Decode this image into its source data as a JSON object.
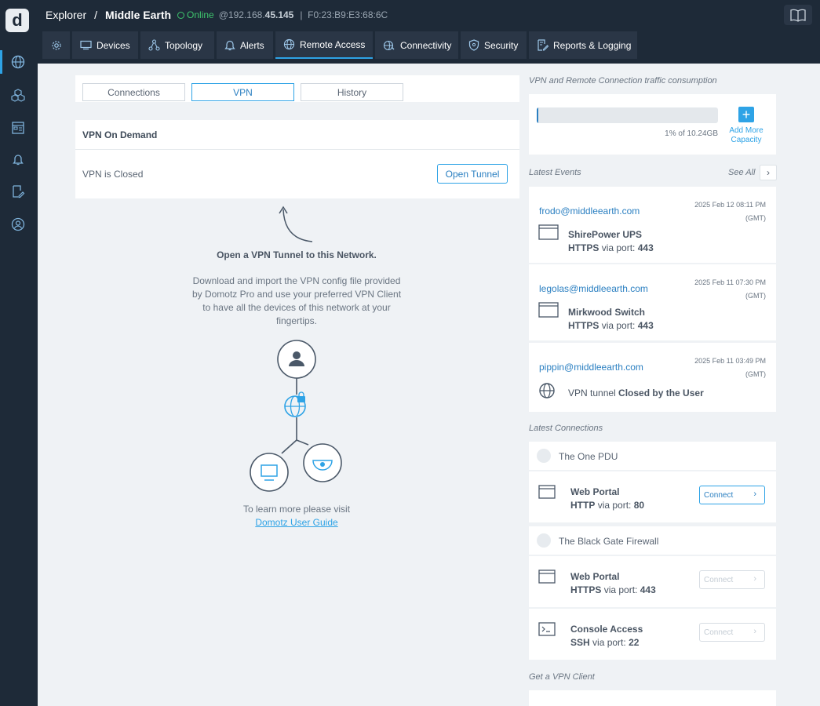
{
  "header": {
    "breadcrumb_root": "Explorer",
    "separator": "/",
    "network_name": "Middle Earth",
    "status": "Online",
    "ip_prefix": "@192.168.",
    "ip_suffix": "45.145",
    "mac_separator": "|",
    "mac": "F0:23:B9:E3:68:6C"
  },
  "tabs": [
    {
      "label": "",
      "icon": "gear-icon"
    },
    {
      "label": "Devices",
      "icon": "monitor-icon"
    },
    {
      "label": "Topology",
      "icon": "topology-icon"
    },
    {
      "label": "Alerts",
      "icon": "bell-icon"
    },
    {
      "label": "Remote Access",
      "icon": "globe-icon",
      "active": true
    },
    {
      "label": "Connectivity",
      "icon": "connectivity-icon"
    },
    {
      "label": "Security",
      "icon": "shield-icon"
    },
    {
      "label": "Reports & Logging",
      "icon": "report-icon"
    }
  ],
  "segments": {
    "connections": "Connections",
    "vpn": "VPN",
    "history": "History",
    "active": "VPN"
  },
  "vpn": {
    "title": "VPN On Demand",
    "status": "VPN is Closed",
    "open_button": "Open Tunnel",
    "empty_title": "Open a VPN Tunnel to this Network.",
    "empty_description": "Download and import the VPN config file provided by Domotz Pro and use your preferred VPN Client to have all the devices of this network at your fingertips.",
    "learn_more": "To learn more please visit",
    "guide_link": "Domotz User Guide"
  },
  "traffic": {
    "label": "VPN and Remote Connection traffic consumption",
    "usage_text": "1% of 10.24GB",
    "usage_fraction": 0.01,
    "add_capacity": "Add More Capacity"
  },
  "events": {
    "label": "Latest Events",
    "see_all": "See All",
    "items": [
      {
        "user": "frodo@middleearth.com",
        "date": "2025 Feb 12 08:11 PM",
        "tz": "(GMT)",
        "device": "ShirePower UPS",
        "proto": "HTTPS",
        "via": "via port:",
        "port": "443"
      },
      {
        "user": "legolas@middleearth.com",
        "date": "2025 Feb 11 07:30 PM",
        "tz": "(GMT)",
        "device": "Mirkwood Switch",
        "proto": "HTTPS",
        "via": "via port:",
        "port": "443"
      },
      {
        "user": "pippin@middleearth.com",
        "date": "2025 Feb 11 03:49 PM",
        "tz": "(GMT)",
        "text_prefix": "VPN tunnel",
        "text_bold": "Closed by the User"
      }
    ]
  },
  "connections": {
    "label": "Latest Connections",
    "groups": [
      {
        "name": "The One PDU",
        "services": [
          {
            "name": "Web Portal",
            "proto": "HTTP",
            "via": "via port:",
            "port": "80",
            "button": "Connect",
            "enabled": true
          }
        ]
      },
      {
        "name": "The Black Gate Firewall",
        "services": [
          {
            "name": "Web Portal",
            "proto": "HTTPS",
            "via": "via port:",
            "port": "443",
            "button": "Connect",
            "enabled": false
          },
          {
            "name": "Console Access",
            "proto": "SSH",
            "via": "via port:",
            "port": "22",
            "button": "Connect",
            "enabled": false
          }
        ]
      }
    ]
  },
  "client": {
    "label": "Get a VPN Client"
  },
  "colors": {
    "accent": "#2ea3e6",
    "online": "#3ec46d",
    "nav_bg": "#1e2a38"
  }
}
